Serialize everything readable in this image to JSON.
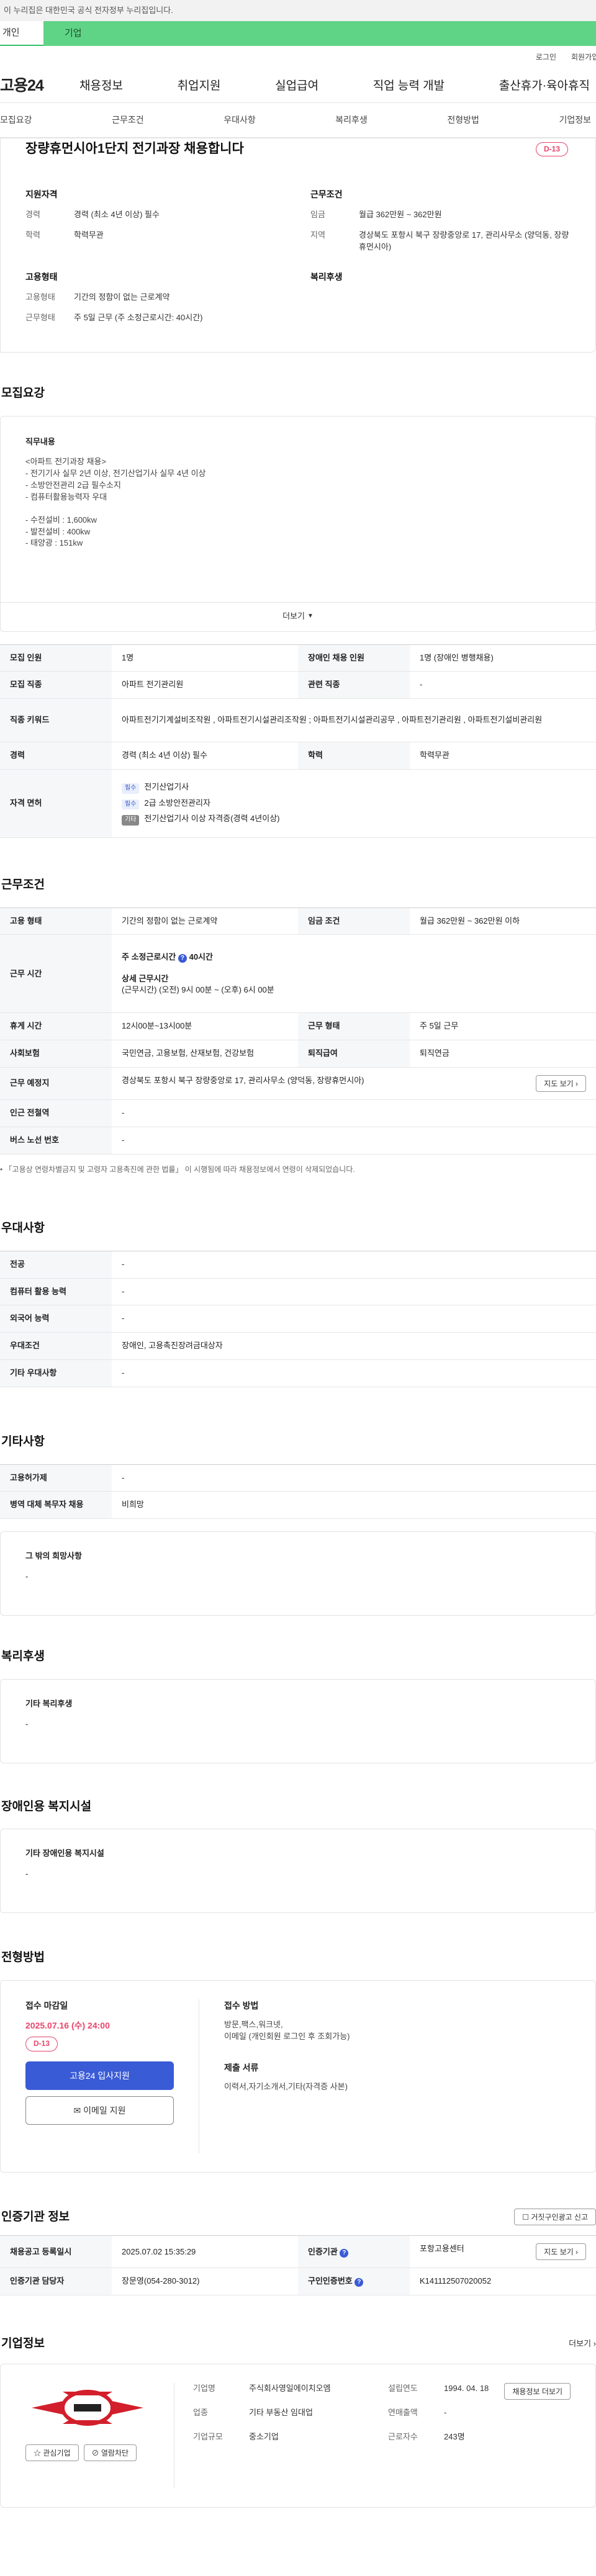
{
  "gov_banner": "이 누리집은 대한민국 공식 전자정부 누리집입니다.",
  "user_tabs": [
    "개인",
    "기업"
  ],
  "util_links": [
    "로그인",
    "회원가입"
  ],
  "site": {
    "logo": "고용24",
    "menu": [
      "채용정보",
      "취업지원",
      "실업급여",
      "직업 능력 개발",
      "출산휴가·육아휴직"
    ]
  },
  "subnav": [
    "모집요강",
    "근무조건",
    "우대사항",
    "복리후생",
    "전형방법",
    "기업정보"
  ],
  "job": {
    "title": "장량휴먼시아1단지 전기과장 채용합니다",
    "dday": "D-13",
    "qual_head": "지원자격",
    "qual": [
      {
        "k": "경력",
        "v": "경력 (최소 4년 이상) 필수"
      },
      {
        "k": "학력",
        "v": "학력무관"
      }
    ],
    "cond_head": "근무조건",
    "cond": [
      {
        "k": "임금",
        "v": "월급 362만원 ~ 362만원"
      },
      {
        "k": "지역",
        "v": "경상북도 포항시 북구 장량중앙로 17, 관리사무소 (양덕동, 장량휴먼시아)"
      }
    ],
    "emp_head": "고용형태",
    "emp": [
      {
        "k": "고용형태",
        "v": "기간의 정함이 없는 근로계약"
      },
      {
        "k": "근무형태",
        "v": "주 5일 근무 (주 소정근로시간: 40시간)"
      }
    ],
    "welfare_head": "복리후생"
  },
  "recruit": {
    "title": "모집요강",
    "duty_head": "직무내용",
    "duty_lines": [
      "<아파트 전기과장 채용>",
      "- 전기기사 실무 2년 이상, 전기산업기사 실무 4년 이상",
      "- 소방안전관리 2급 필수소지",
      "- 컴퓨터활용능력자 우대",
      "",
      "- 수전설비 : 1,600kw",
      "- 발전설비 : 400kw",
      "- 태양광 : 151kw"
    ],
    "more": "더보기",
    "rows": {
      "count_k": "모집 인원",
      "count_v": "1명",
      "disabled_k": "장애인 채용 인원",
      "disabled_v": "1명 (장애인 병행채용)",
      "job_k": "모집 직종",
      "job_v": "아파트 전기관리원",
      "rel_k": "관련 직종",
      "rel_v": "-",
      "kw_k": "직종 키워드",
      "kw_v": "아파트전기기계설비조작원 , 아파트전기시설관리조작원 ; 아파트전기시설관리공무 , 아파트전기관리원 , 아파트전기설비관리원",
      "exp_k": "경력",
      "exp_v": "경력 (최소 4년 이상) 필수",
      "edu_k": "학력",
      "edu_v": "학력무관",
      "lic_k": "자격 면허",
      "lic": [
        {
          "b": "필수",
          "v": "전기산업기사"
        },
        {
          "b": "필수",
          "v": "2급 소방안전관리자"
        },
        {
          "b": "기타",
          "v": "전기산업기사 이상 자격증(경력 4년이상)"
        }
      ]
    }
  },
  "work": {
    "title": "근무조건",
    "type_k": "고용 형태",
    "type_v": "기간의 정함이 없는 근로계약",
    "wage_k": "임금 조건",
    "wage_v": "월급 362만원 ~ 362만원 이하",
    "time_k": "근무 시간",
    "time_a": "주 소정근로시간",
    "time_b": "40시간",
    "time_c": "상세 근무시간",
    "time_d": "(근무시간) (오전) 9시 00분 ~ (오후) 6시 00분",
    "rest_k": "휴게 시간",
    "rest_v": "12시00분~13시00분",
    "form_k": "근무 형태",
    "form_v": "주 5일 근무",
    "ins_k": "사회보험",
    "ins_v": "국민연금, 고용보험, 산재보험, 건강보험",
    "ret_k": "퇴직급여",
    "ret_v": "퇴직연금",
    "loc_k": "근무 예정지",
    "loc_v": "경상북도 포항시 북구 장량중앙로 17, 관리사무소 (양덕동, 장량휴먼시아)",
    "map": "지도 보기",
    "sub_k": "인근 전철역",
    "sub_v": "-",
    "bus_k": "버스 노선 번호",
    "bus_v": "-",
    "note": "「고용상 연령차별금지 및 고령자 고용촉진에 관한 법률」 이 시행됨에 따라 채용정보에서 연령이 삭제되었습니다."
  },
  "prefer": {
    "title": "우대사항",
    "rows": [
      {
        "k": "전공",
        "v": "-"
      },
      {
        "k": "컴퓨터 활용 능력",
        "v": "-"
      },
      {
        "k": "외국어 능력",
        "v": "-"
      },
      {
        "k": "우대조건",
        "v": "장애인, 고용촉진장려금대상자"
      },
      {
        "k": "기타 우대사항",
        "v": "-"
      }
    ]
  },
  "etc": {
    "title": "기타사항",
    "rows": [
      {
        "k": "고용허가제",
        "v": "-"
      },
      {
        "k": "병역 대체 복무자 채용",
        "v": "비희망"
      }
    ],
    "wish_h": "그 밖의 희망사항",
    "wish_v": "-"
  },
  "benefit": {
    "title": "복리후생",
    "h": "기타 복리후생",
    "v": "-"
  },
  "disab": {
    "title": "장애인용 복지시설",
    "h": "기타 장애인용 복지시설",
    "v": "-"
  },
  "process": {
    "title": "전형방법",
    "deadline_h": "접수 마감일",
    "deadline": "2025.07.16 (수) 24:00",
    "dday": "D-13",
    "apply": "고용24 입사지원",
    "email": "이메일 지원",
    "method_h": "접수 방법",
    "method_v1": "방문,팩스,워크넷,",
    "method_v2": "이메일 (개인회원 로그인 후 조회가능)",
    "docs_h": "제출 서류",
    "docs_v": "이력서,자기소개서,기타(자격증 사본)"
  },
  "cert": {
    "title": "인증기관 정보",
    "report": "거짓구인광고 신고",
    "reg_k": "채용공고 등록일시",
    "reg_v": "2025.07.02 15:35:29",
    "org_k": "인증기관",
    "org_v": "포항고용센터",
    "map": "지도 보기",
    "mgr_k": "인증기관 담당자",
    "mgr_v": "장문영(054-280-3012)",
    "num_k": "구인인증번호",
    "num_v": "K141112507020052"
  },
  "comp": {
    "title": "기업정보",
    "more": "더보기",
    "fav": "관심기업",
    "block": "열람차단",
    "name_k": "기업명",
    "name_v": "주식회사영일에이치오엠",
    "ind_k": "업종",
    "ind_v": "기타 부동산 임대업",
    "size_k": "기업규모",
    "size_v": "중소기업",
    "est_k": "설립연도",
    "est_v": "1994. 04. 18",
    "sales_k": "연매출액",
    "sales_v": "-",
    "emp_k": "근로자수",
    "emp_v": "243명",
    "view": "채용정보 더보기"
  }
}
